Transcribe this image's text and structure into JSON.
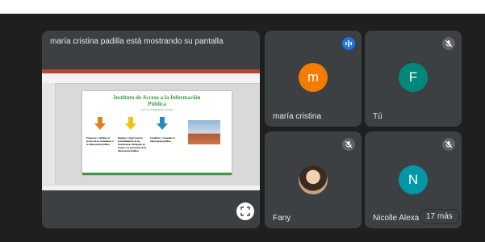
{
  "presentation": {
    "banner": "maría cristina padilla está mostrando su pantalla",
    "slide_title_line1": "Instituto de Acceso a la Información",
    "slide_title_line2": "Pública",
    "slide_subtitle": "(Art 74, 75 Reglamento LGAIP)",
    "col1_text": "Promover y facilitar el acceso de los ciudadanos a la información pública",
    "col2_text": "Regular y supervisar los procedimientos de las Instituciones Obligadas en cuanto a la protección de la información pública",
    "col3_text": "Clasificar y custodiar la información pública"
  },
  "participants": [
    {
      "name": "maría cristina",
      "initial": "m",
      "avatar_color": "#f57c00",
      "mic": "speaking"
    },
    {
      "name": "Tú",
      "initial": "F",
      "avatar_color": "#00897b",
      "mic": "muted"
    },
    {
      "name": "Fany",
      "initial": "",
      "avatar_color": "#c9a27a",
      "mic": "muted"
    },
    {
      "name": "Nicolle Alexa",
      "initial": "N",
      "avatar_color": "#0097a7",
      "mic": "muted"
    }
  ],
  "more_count": "17 más",
  "colors": {
    "tile_bg": "#3c4043",
    "stage_bg": "#1f1f20",
    "ppt_red": "#b7472a",
    "slide_green": "#3a9a3f",
    "arrow_orange": "#e67e22",
    "arrow_yellow": "#f1c40f",
    "arrow_blue": "#2e86c1"
  },
  "icons": [
    "mic-speaking-icon",
    "mic-off-icon",
    "fullscreen-icon"
  ]
}
